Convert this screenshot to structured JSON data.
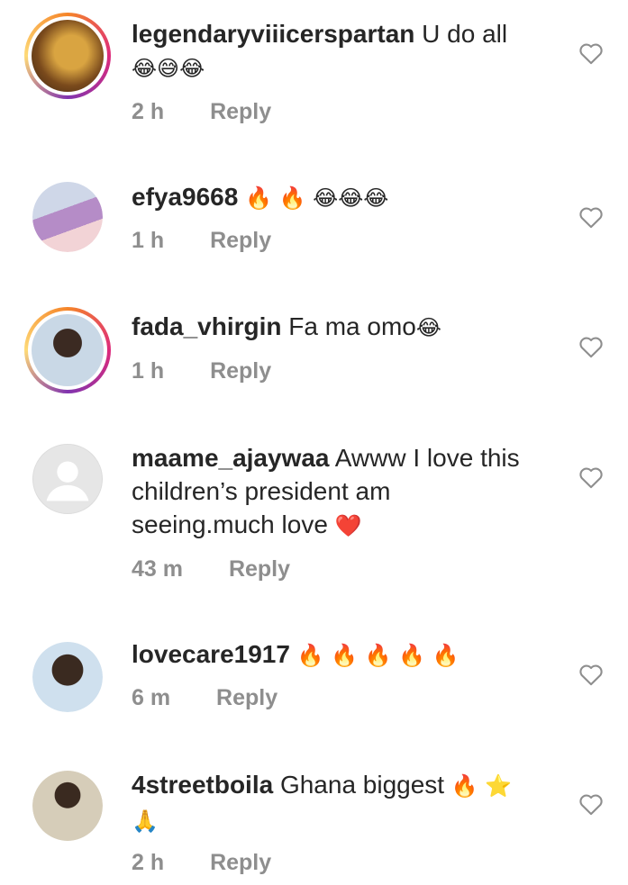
{
  "comments": [
    {
      "username": "legendaryviiicerspartan",
      "text": "U do all",
      "emoji": "😂😅😂",
      "time": "2 h",
      "reply": "Reply"
    },
    {
      "username": "efya9668",
      "text": "",
      "emoji": "🔥 🔥 😂😂😂",
      "time": "1 h",
      "reply": "Reply"
    },
    {
      "username": "fada_vhirgin",
      "text": "Fa ma omo",
      "emoji": "😂",
      "time": "1 h",
      "reply": "Reply"
    },
    {
      "username": "maame_ajaywaa",
      "text": "Awww I love this children’s president am seeing.much love",
      "emoji": "❤️",
      "time": "43 m",
      "reply": "Reply"
    },
    {
      "username": "lovecare1917",
      "text": "",
      "emoji": "🔥 🔥 🔥 🔥 🔥",
      "time": "6 m",
      "reply": "Reply"
    },
    {
      "username": "4streetboila",
      "text": "Ghana biggest",
      "emoji": "🔥 ⭐🙏",
      "time": "2 h",
      "reply": "Reply"
    }
  ],
  "icons": {
    "like": "heart-outline-icon"
  },
  "colors": {
    "text": "#262626",
    "meta": "#8e8e8e",
    "story_ring_start": "#f58529",
    "story_ring_end": "#8134af"
  }
}
